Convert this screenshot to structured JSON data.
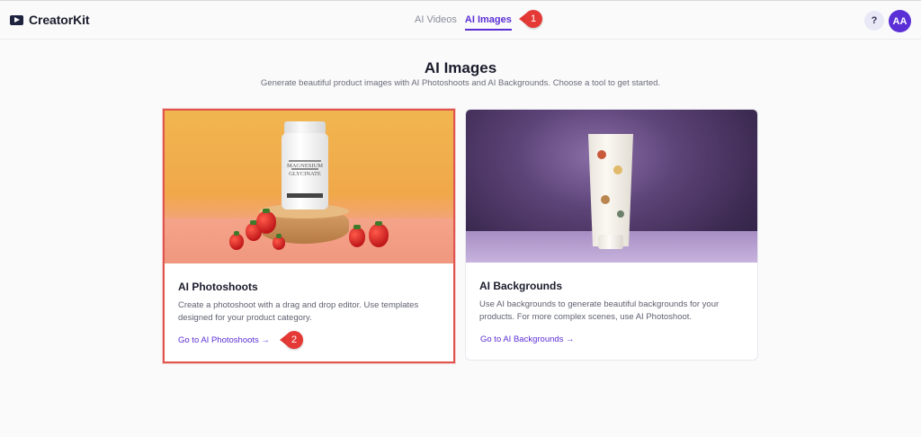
{
  "app": {
    "name": "CreatorKit"
  },
  "nav": {
    "tabs": [
      {
        "label": "AI Videos",
        "active": false
      },
      {
        "label": "AI Images",
        "active": true
      }
    ]
  },
  "header": {
    "help_label": "?",
    "avatar_initials": "AA"
  },
  "annotations": [
    {
      "number": "1"
    },
    {
      "number": "2"
    }
  ],
  "page": {
    "title": "AI Images",
    "subtitle": "Generate beautiful product images with AI Photoshoots and AI Backgrounds. Choose a tool to get started."
  },
  "cards": [
    {
      "title": "AI Photoshoots",
      "description": "Create a photoshoot with a drag and drop editor. Use templates designed for your product category.",
      "link": "Go to AI Photoshoots →",
      "selected": true,
      "image_labels": [
        "MAGNESIUM",
        "GLYCINATE"
      ]
    },
    {
      "title": "AI Backgrounds",
      "description": "Use AI backgrounds to generate beautiful backgrounds for your products. For more complex scenes, use AI Photoshoot.",
      "link": "Go to AI Backgrounds →",
      "selected": false
    }
  ],
  "colors": {
    "accent": "#5b2fd6",
    "annotation": "#e53935",
    "selection_border": "#e0554e"
  }
}
